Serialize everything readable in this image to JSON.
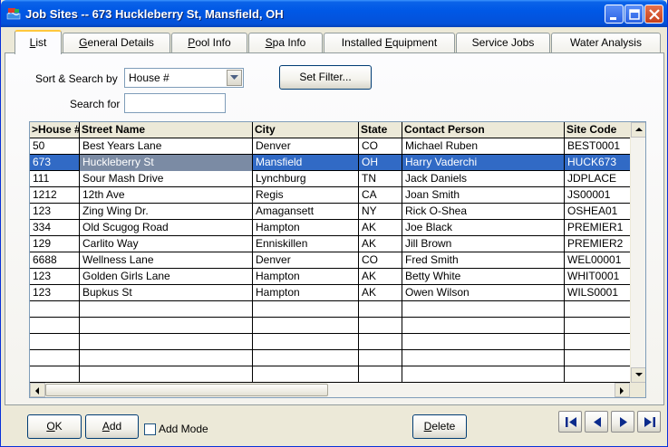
{
  "window": {
    "title": "Job Sites -- 673 Huckleberry St, Mansfield, OH"
  },
  "tabs": [
    {
      "pre": "",
      "key": "L",
      "post": "ist",
      "active": true
    },
    {
      "pre": "",
      "key": "G",
      "post": "eneral Details",
      "active": false
    },
    {
      "pre": "",
      "key": "P",
      "post": "ool Info",
      "active": false
    },
    {
      "pre": "",
      "key": "S",
      "post": "pa Info",
      "active": false
    },
    {
      "pre": "Installed ",
      "key": "E",
      "post": "quipment",
      "active": false
    },
    {
      "pre": "Service Jobs",
      "key": "",
      "post": "",
      "active": false
    },
    {
      "pre": "Water Analysis",
      "key": "",
      "post": "",
      "active": false
    }
  ],
  "filter": {
    "sort_label": "Sort & Search by",
    "sort_value": "House #",
    "search_label": "Search for",
    "search_value": "",
    "set_filter_label": "Set Filter..."
  },
  "grid": {
    "columns": [
      ">House #",
      "Street Name",
      "City",
      "State",
      "Contact Person",
      "Site Code"
    ],
    "rows": [
      [
        "50",
        "Best Years Lane",
        "Denver",
        "CO",
        "Michael Ruben",
        "BEST0001"
      ],
      [
        "673",
        "Huckleberry St",
        "Mansfield",
        "OH",
        "Harry Vaderchi",
        "HUCK673"
      ],
      [
        "111",
        "Sour Mash Drive",
        "Lynchburg",
        "TN",
        "Jack Daniels",
        "JDPLACE"
      ],
      [
        "1212",
        "12th Ave",
        "Regis",
        "CA",
        "Joan Smith",
        "JS00001"
      ],
      [
        "123",
        "Zing Wing Dr.",
        "Amagansett",
        "NY",
        "Rick O-Shea",
        "OSHEA01"
      ],
      [
        "334",
        "Old Scugog Road",
        "Hampton",
        "AK",
        "Joe Black",
        "PREMIER1"
      ],
      [
        "129",
        "Carlito Way",
        "Enniskillen",
        "AK",
        "Jill Brown",
        "PREMIER2"
      ],
      [
        "6688",
        "Wellness Lane",
        "Denver",
        "CO",
        "Fred Smith",
        "WEL00001"
      ],
      [
        "123",
        "Golden Girls Lane",
        "Hampton",
        "AK",
        "Betty White",
        "WHIT0001"
      ],
      [
        "123",
        "Bupkus St",
        "Hampton",
        "AK",
        "Owen Wilson",
        "WILS0001"
      ],
      [
        "",
        "",
        "",
        "",
        "",
        ""
      ],
      [
        "",
        "",
        "",
        "",
        "",
        ""
      ],
      [
        "",
        "",
        "",
        "",
        "",
        ""
      ],
      [
        "",
        "",
        "",
        "",
        "",
        ""
      ],
      [
        "",
        "",
        "",
        "",
        "",
        ""
      ]
    ],
    "selected_row": 1
  },
  "bottom": {
    "ok_key": "O",
    "ok_rest": "K",
    "add_key": "A",
    "add_rest": "dd",
    "add_mode_label": "Add Mode",
    "add_mode_checked": false,
    "delete_key": "D",
    "delete_rest": "elete"
  },
  "colors": {
    "titlebar": "#0058e6",
    "selection": "#316ac5",
    "active_tab_accent": "#ffc73c"
  }
}
